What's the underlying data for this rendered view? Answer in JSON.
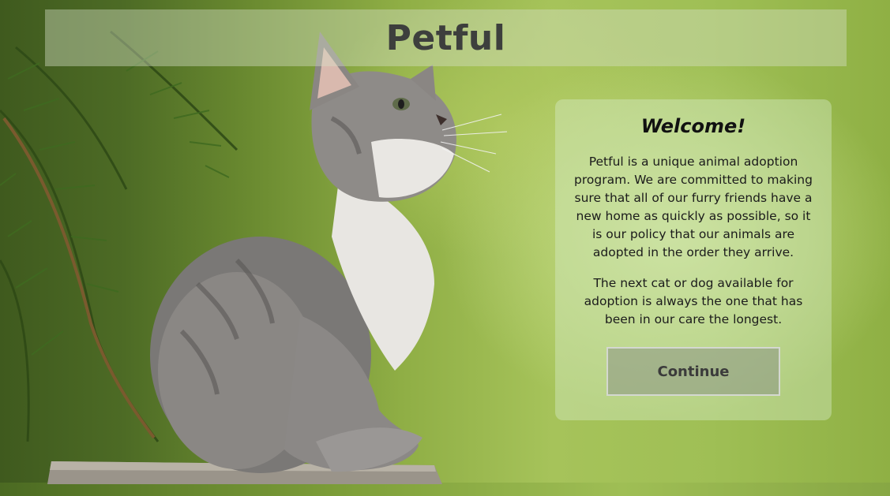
{
  "header": {
    "title": "Petful"
  },
  "welcome": {
    "heading": "Welcome!",
    "paragraph_1": "Petful is a unique animal adoption program. We are committed to making sure that all of our furry friends have a new home as quickly as possible, so it is our policy that our animals are adopted in the order they arrive.",
    "paragraph_2": "The next cat or dog available for adoption is always the one that has been in our care the longest.",
    "continue_label": "Continue"
  },
  "colors": {
    "title_text": "#3d3f3d",
    "card_text": "#1b1b1b",
    "button_text": "#3b3b3b"
  }
}
